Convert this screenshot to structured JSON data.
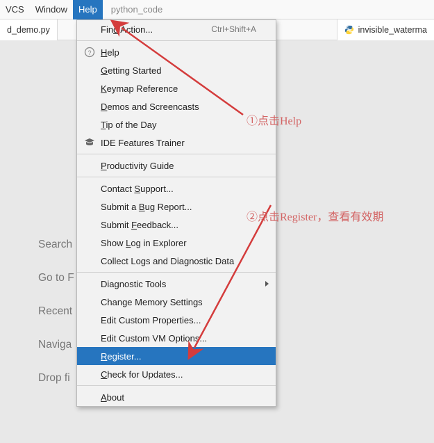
{
  "menubar": {
    "vcs": "VCS",
    "window": "Window",
    "help": "Help",
    "extra_text": "python_code"
  },
  "tabs": {
    "left": "d_demo.py",
    "right": "invisible_waterma"
  },
  "welcome": {
    "search": "Search",
    "goto": "Go to F",
    "recent": "Recent",
    "nav": "Naviga",
    "drop": "Drop fi"
  },
  "help_menu": {
    "find_action": {
      "pre": "Fin",
      "m": "d",
      "post": " Action...",
      "shortcut": "Ctrl+Shift+A"
    },
    "help": {
      "pre": "",
      "m": "H",
      "post": "elp"
    },
    "getting_started": {
      "pre": "",
      "m": "G",
      "post": "etting Started"
    },
    "keymap": {
      "pre": "",
      "m": "K",
      "post": "eymap Reference"
    },
    "demos": {
      "pre": "",
      "m": "D",
      "post": "emos and Screencasts"
    },
    "tip": {
      "pre": "",
      "m": "T",
      "post": "ip of the Day"
    },
    "ide_trainer": {
      "pre": "IDE Features Trainer"
    },
    "productivity": {
      "pre": "",
      "m": "P",
      "post": "roductivity Guide"
    },
    "contact": {
      "pre": "Contact ",
      "m": "S",
      "post": "upport..."
    },
    "bug": {
      "pre": "Submit a ",
      "m": "B",
      "post": "ug Report..."
    },
    "feedback": {
      "pre": "Submit ",
      "m": "F",
      "post": "eedback..."
    },
    "showlog": {
      "pre": "Show ",
      "m": "L",
      "post": "og in Explorer"
    },
    "collect": {
      "pre": "Collect Logs and Diagnostic Data"
    },
    "diag": {
      "pre": "Diagnostic Tools"
    },
    "memory": {
      "pre": "Change Memory Settings"
    },
    "props": {
      "pre": "Edit Custom Properties..."
    },
    "vmopts": {
      "pre": "Edit Custom VM Options..."
    },
    "register": {
      "pre": "",
      "m": "R",
      "post": "egister..."
    },
    "updates": {
      "pre": "",
      "m": "C",
      "post": "heck for Updates..."
    },
    "about": {
      "pre": "",
      "m": "A",
      "post": "bout"
    }
  },
  "annotations": {
    "a1": "①点击Help",
    "a2": "②点击Register，查看有效期"
  }
}
